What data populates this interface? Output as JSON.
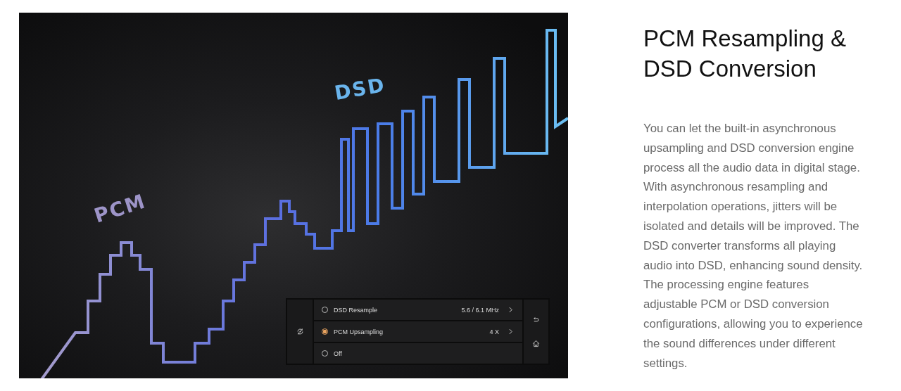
{
  "image": {
    "labels": [
      {
        "text": "PCM"
      },
      {
        "text": "DSD"
      }
    ]
  },
  "panel": {
    "options": [
      {
        "label": "DSD Resample",
        "value": "5.6 / 6.1 MHz",
        "selected": false,
        "chevron": true
      },
      {
        "label": "PCM Upsampling",
        "value": "4 X",
        "selected": true,
        "chevron": true
      },
      {
        "label": "Off",
        "selected": false,
        "chevron": false
      }
    ]
  },
  "heading": "PCM Resampling & DSD Conversion",
  "body": "You can let the built-in asynchronous upsampling and DSD conversion engine process all the audio data in digital stage. With asynchronous resampling and interpolation operations, jitters will be isolated and details will be improved. The DSD converter transforms all playing audio into DSD, enhancing sound density. The processing engine features adjustable PCM or DSD conversion configurations, allowing you to experience the sound differences under different settings."
}
